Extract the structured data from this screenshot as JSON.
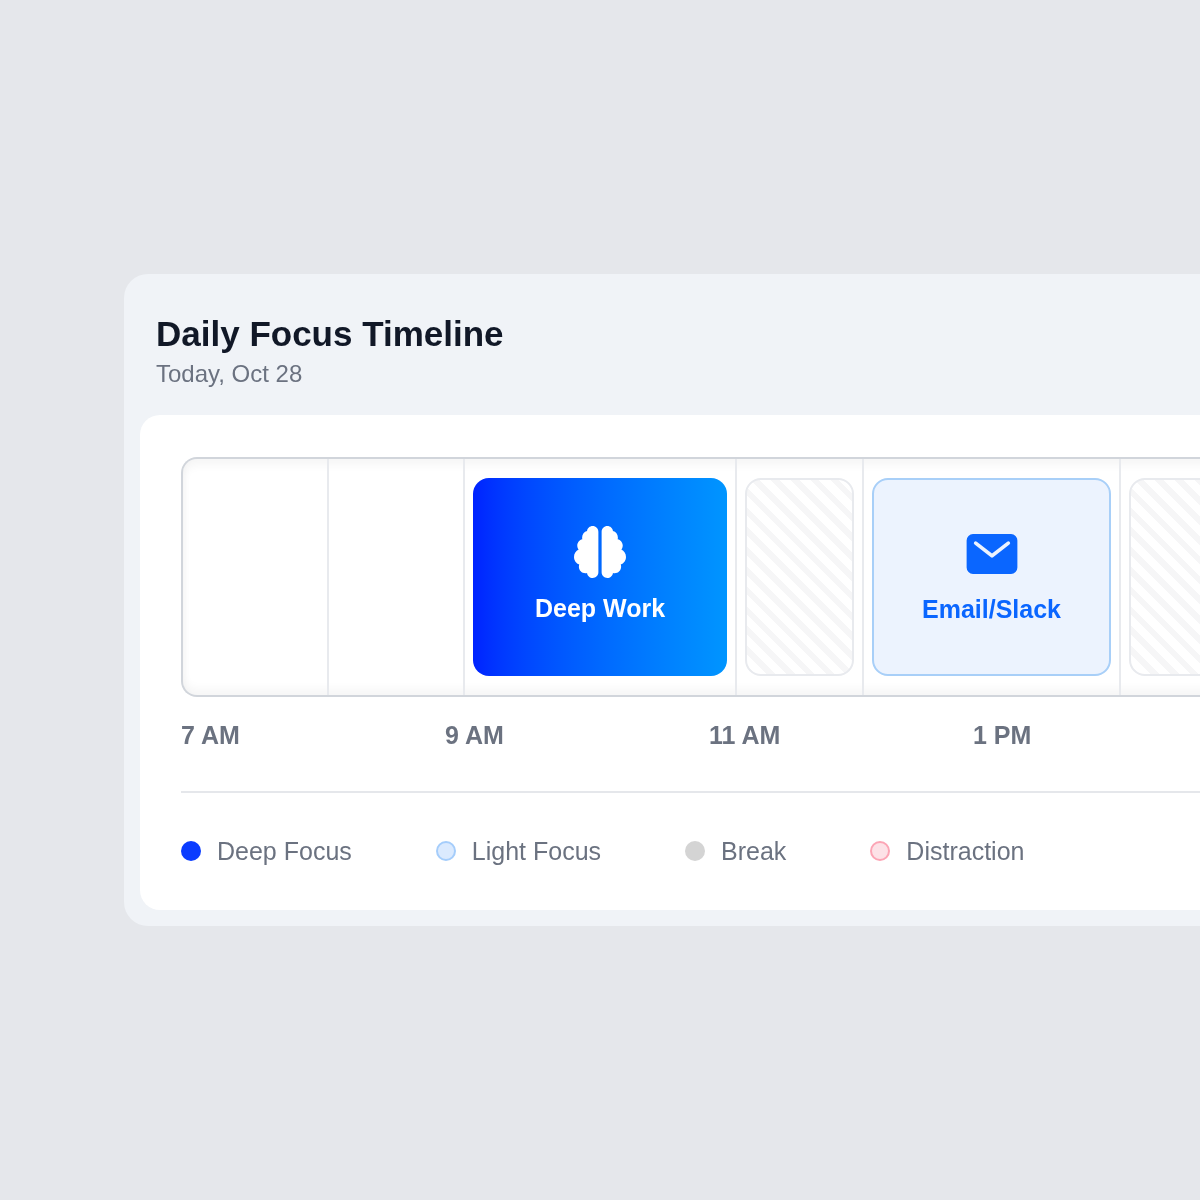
{
  "card": {
    "title": "Daily Focus Timeline",
    "subtitle": "Today, Oct 28"
  },
  "timeline": {
    "segments": [
      {
        "kind": "empty"
      },
      {
        "kind": "empty"
      },
      {
        "kind": "deep",
        "label": "Deep Work"
      },
      {
        "kind": "break"
      },
      {
        "kind": "light",
        "label": "Email/Slack"
      },
      {
        "kind": "break"
      }
    ],
    "hour_labels": [
      "7 AM",
      "9 AM",
      "11 AM",
      "1 PM"
    ]
  },
  "legend": [
    {
      "kind": "solid",
      "label": "Deep Focus",
      "color": "#0a3cff"
    },
    {
      "kind": "ring",
      "label": "Light Focus",
      "color": "#dbeafe"
    },
    {
      "kind": "solid",
      "label": "Break",
      "color": "#d4d4d4"
    },
    {
      "kind": "ring",
      "label": "Distraction",
      "color": "#fde2e7"
    }
  ]
}
